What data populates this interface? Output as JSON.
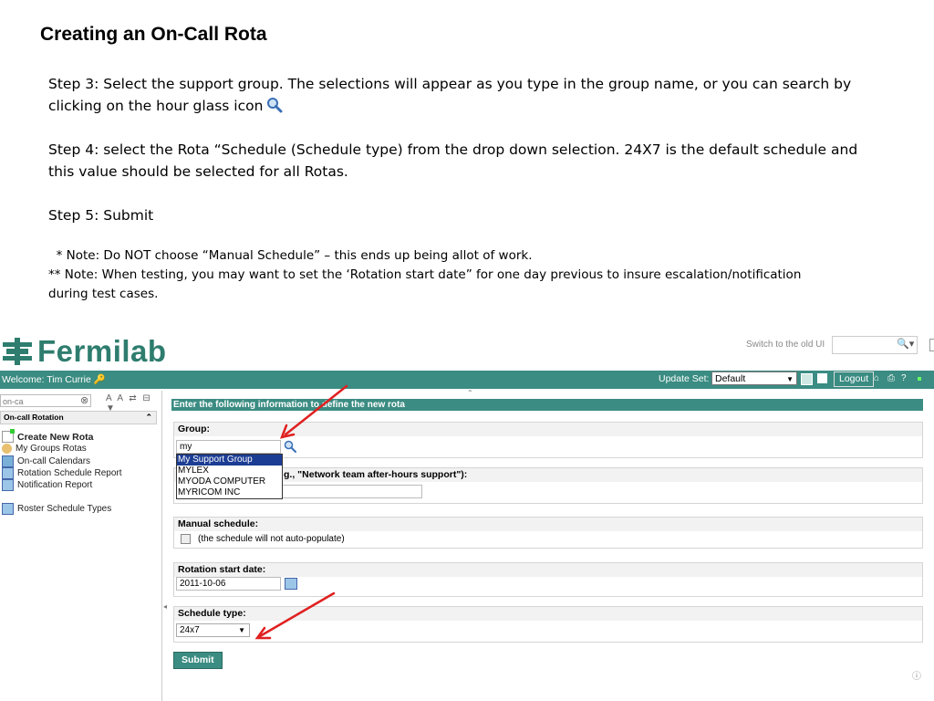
{
  "slide": {
    "title": "Creating an On-Call Rota",
    "step3": "Step 3: Select the support group. The selections will appear as you type in the group name, or you can search by clicking on the hour glass icon",
    "step4": "Step 4: select the Rota “Schedule (Schedule type) from the drop down selection. 24X7 is the default schedule and this value should be selected for all Rotas.",
    "step5": "Step 5: Submit",
    "note1": "  * Note: Do NOT choose “Manual Schedule” – this ends up being allot of work.",
    "note2": "** Note: When testing, you may want to set the ‘Rotation start date” for one day previous to insure escalation/notification during test cases."
  },
  "app": {
    "logo_text": "Fermilab",
    "switch_ui": "Switch to the old UI",
    "welcome": "Welcome: Tim Currie",
    "update_set_label": "Update Set:",
    "update_set_value": "Default",
    "logout": "Logout",
    "nav_filter": "on-ca",
    "nav_section": "On-call Rotation",
    "nav_items": [
      "Create New Rota",
      "My Groups Rotas",
      "On-call Calendars",
      "Rotation Schedule Report",
      "Notification Report",
      "Roster Schedule Types"
    ],
    "form_header": "Enter the following information to define the new rota",
    "group_label": "Group:",
    "group_value": "my",
    "group_options": [
      "My Support Group",
      "MYLEX",
      "MYODA COMPUTER",
      "MYRICOM INC"
    ],
    "name_label_partial": "g., \"Network team after-hours support\"):",
    "manual_label": "Manual schedule:",
    "manual_desc": "(the schedule will not auto-populate)",
    "start_label": "Rotation start date:",
    "start_value": "2011-10-06",
    "schedule_label": "Schedule type:",
    "schedule_value": "24x7",
    "submit": "Submit"
  },
  "colors": {
    "teal": "#3b8c82",
    "selection": "#1c3d94",
    "arrow": "#e02020"
  }
}
